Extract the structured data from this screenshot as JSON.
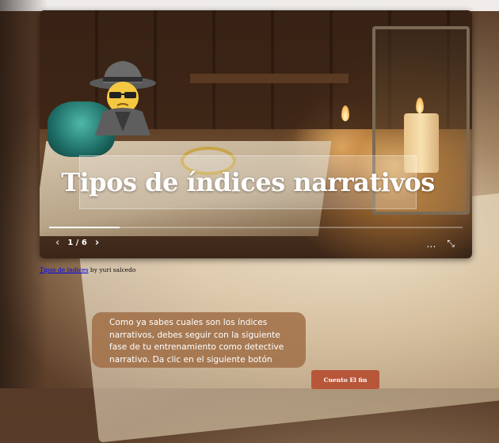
{
  "slide": {
    "title": "Tipos de índices narrativos",
    "pager_text": "1 / 6",
    "progress_fraction": 0.17,
    "prev_icon": "chevron-left-icon",
    "next_icon": "chevron-right-icon",
    "more_icon": "more-icon",
    "fullscreen_icon": "fullscreen-icon",
    "detective_icon": "detective-emoji-icon"
  },
  "credit": {
    "link_text": "Tipos de índices",
    "author_text": "by yuri salcedo"
  },
  "message": {
    "text": "Como ya sabes cuales son los índices narrativos, debes seguir con la siguiente fase de tu entrenamiento como detective narrativo. Da clic en el siguiente botón"
  },
  "button": {
    "label": "Cuento El fin"
  },
  "colors": {
    "button_bg": "#b8563a",
    "message_bg": "#a06e46"
  }
}
